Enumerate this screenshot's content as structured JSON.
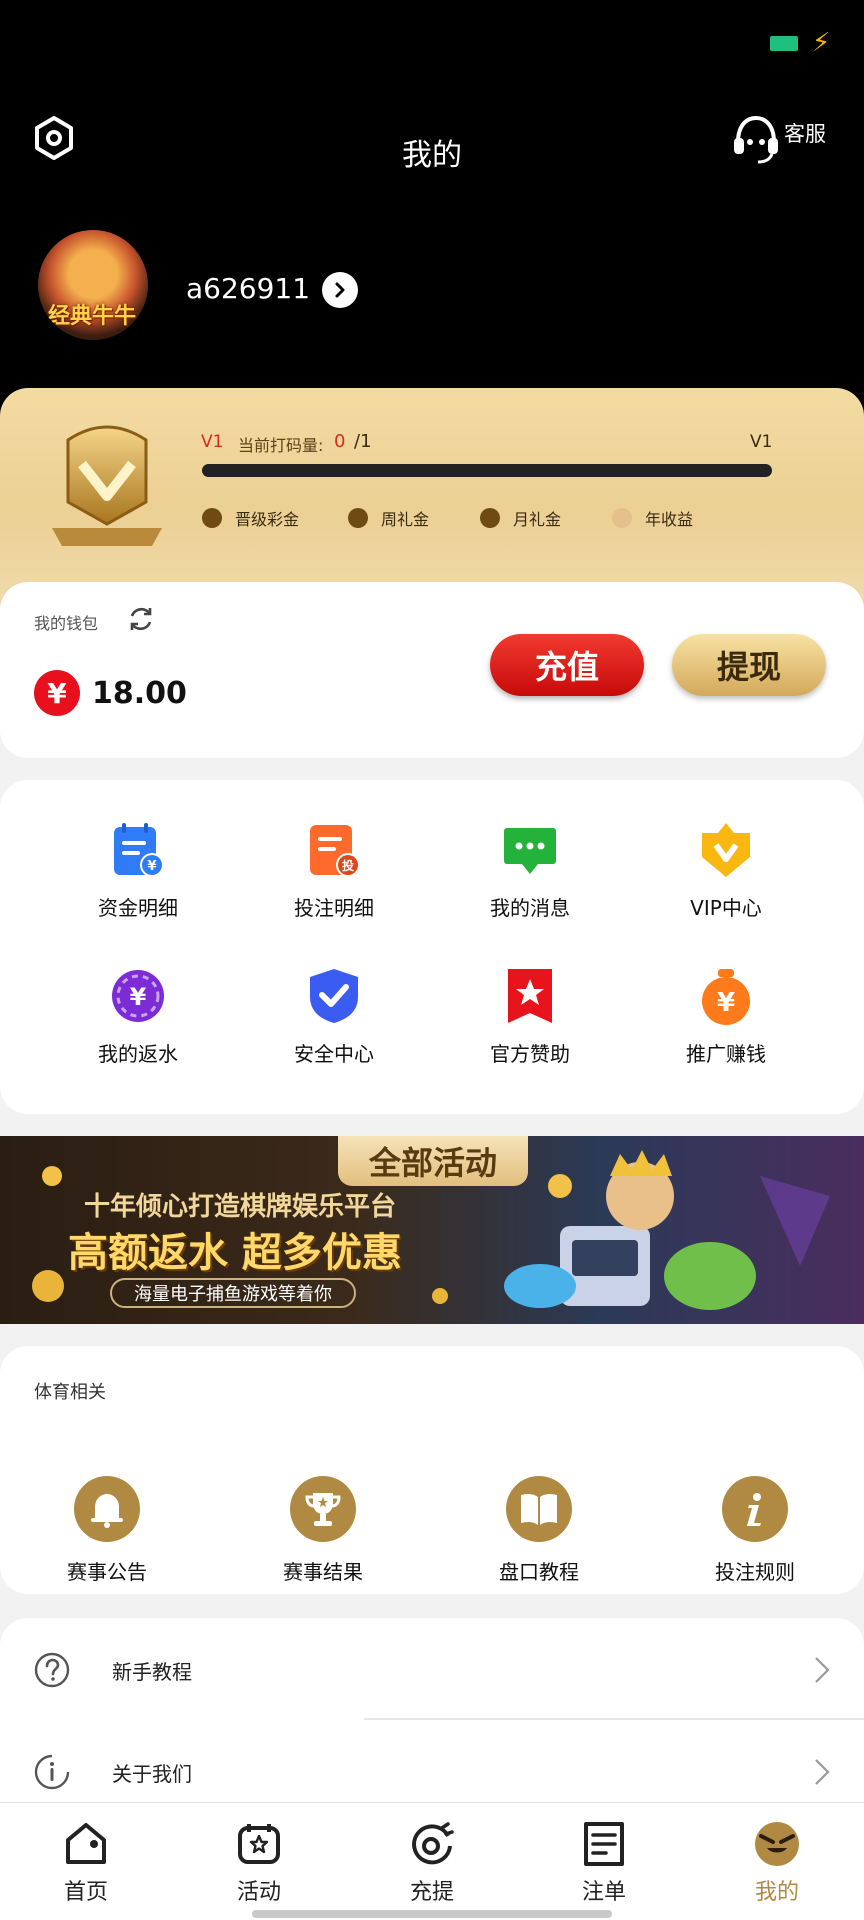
{
  "header": {
    "title": "我的",
    "service_label": "客服"
  },
  "user": {
    "username": "a626911",
    "avatar_text": "经典牛牛"
  },
  "vip": {
    "level": "V1",
    "bet_label": "当前打码量:",
    "bet_current": "0",
    "bet_sep": "/1",
    "next_level": "V1",
    "progress": 0,
    "perks": [
      "晋级彩金",
      "周礼金",
      "月礼金",
      "年收益"
    ]
  },
  "wallet": {
    "label": "我的钱包",
    "currency_symbol": "¥",
    "balance": "18.00",
    "recharge_label": "充值",
    "withdraw_label": "提现"
  },
  "menu": {
    "items": [
      {
        "label": "资金明细",
        "icon": "fund-details-icon"
      },
      {
        "label": "投注明细",
        "icon": "bet-details-icon"
      },
      {
        "label": "我的消息",
        "icon": "message-icon"
      },
      {
        "label": "VIP中心",
        "icon": "vip-icon"
      },
      {
        "label": "我的返水",
        "icon": "rebate-icon"
      },
      {
        "label": "安全中心",
        "icon": "shield-icon"
      },
      {
        "label": "官方赞助",
        "icon": "sponsor-icon"
      },
      {
        "label": "推广赚钱",
        "icon": "promote-icon"
      }
    ]
  },
  "banner": {
    "tab": "全部活动",
    "line1": "十年倾心打造棋牌娱乐平台",
    "line2": "高额返水 超多优惠",
    "line3": "海量电子捕鱼游戏等着你"
  },
  "sports": {
    "title": "体育相关",
    "items": [
      {
        "label": "赛事公告",
        "icon": "bell-icon"
      },
      {
        "label": "赛事结果",
        "icon": "trophy-icon"
      },
      {
        "label": "盘口教程",
        "icon": "book-icon"
      },
      {
        "label": "投注规则",
        "icon": "info-icon"
      }
    ]
  },
  "list": {
    "items": [
      {
        "label": "新手教程",
        "icon": "question-icon"
      },
      {
        "label": "关于我们",
        "icon": "about-icon"
      }
    ]
  },
  "tabbar": {
    "items": [
      {
        "label": "首页",
        "icon": "home-icon"
      },
      {
        "label": "活动",
        "icon": "activity-icon"
      },
      {
        "label": "充提",
        "icon": "deposit-icon"
      },
      {
        "label": "注单",
        "icon": "orders-icon"
      },
      {
        "label": "我的",
        "icon": "profile-icon"
      }
    ],
    "active": "我的"
  },
  "colors": {
    "accent_gold": "#b08a43",
    "recharge_red": "#e8101c",
    "vip_red": "#d82a1d"
  }
}
